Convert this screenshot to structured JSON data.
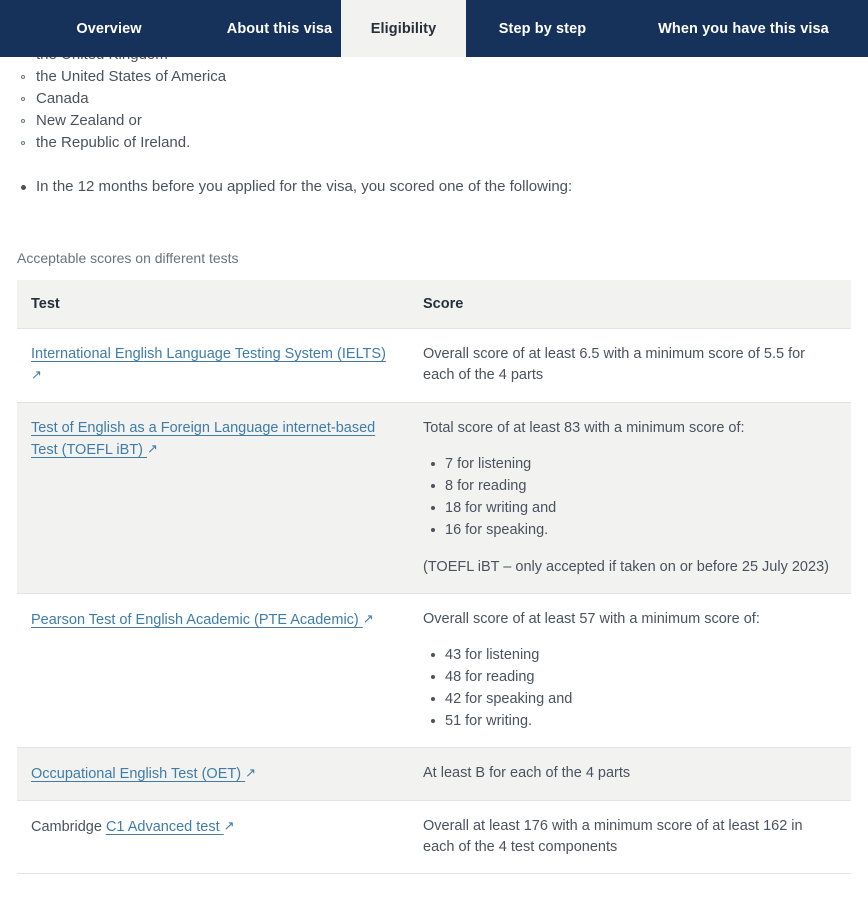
{
  "nav": {
    "tabs": [
      {
        "label": "Overview",
        "active": false
      },
      {
        "label": "About this visa",
        "active": false
      },
      {
        "label": "Eligibility",
        "active": true
      },
      {
        "label": "Step by step",
        "active": false
      },
      {
        "label": "When you have this visa",
        "active": false
      }
    ]
  },
  "country_list": {
    "items": [
      "the United Kingdom",
      "the United States of America",
      "Canada",
      "New Zealand or",
      "the Republic of Ireland."
    ]
  },
  "scored_bullet": "In the 12 months before you applied for the visa, you scored one of the following:",
  "table": {
    "caption": "Acceptable scores on different tests",
    "headers": {
      "test": "Test",
      "score": "Score"
    },
    "rows": [
      {
        "shaded": false,
        "test_prefix": "",
        "test_link": "International English Language Testing System (IELTS)",
        "link_arrow": "↗",
        "score_intro": "Overall score of at least 6.5 with a minimum score of 5.5 for each of the 4 parts",
        "score_list": [],
        "score_note": ""
      },
      {
        "shaded": true,
        "test_prefix": "",
        "test_link": "Test of English as a Foreign Language internet-based Test (TOEFL iBT)",
        "link_arrow": "↗",
        "score_intro": "Total score of at least 83 with a minimum score of:",
        "score_list": [
          "7 for listening",
          "8 for reading",
          "18 for writing and",
          "16 for speaking."
        ],
        "score_note": "(TOEFL iBT – only accepted if taken on or before 25 July 2023)"
      },
      {
        "shaded": false,
        "test_prefix": "",
        "test_link": "Pearson Test of English Academic (PTE Academic)",
        "link_arrow": "↗",
        "score_intro": "Overall score of at least 57 with a minimum score of:",
        "score_list": [
          "43 for listening",
          "48 for reading",
          "42 for speaking and",
          "51 for writing."
        ],
        "score_note": ""
      },
      {
        "shaded": true,
        "test_prefix": "",
        "test_link": "Occupational English Test (OET)",
        "link_arrow": "↗",
        "score_intro": "At least B for each of the 4 parts",
        "score_list": [],
        "score_note": ""
      },
      {
        "shaded": false,
        "test_prefix": "Cambridge ",
        "test_link": "C1 Advanced test",
        "link_arrow": "↗",
        "score_intro": "Overall at least 176 with a minimum score of at least 162 in each of the 4 test components",
        "score_list": [],
        "score_note": ""
      }
    ]
  },
  "colors": {
    "nav_navy": "#16315a",
    "active_tab_bg": "#f2f2f1",
    "link_blue": "#3f7ca8",
    "body_text": "#4a525e",
    "row_shade": "#f2f2f1"
  }
}
